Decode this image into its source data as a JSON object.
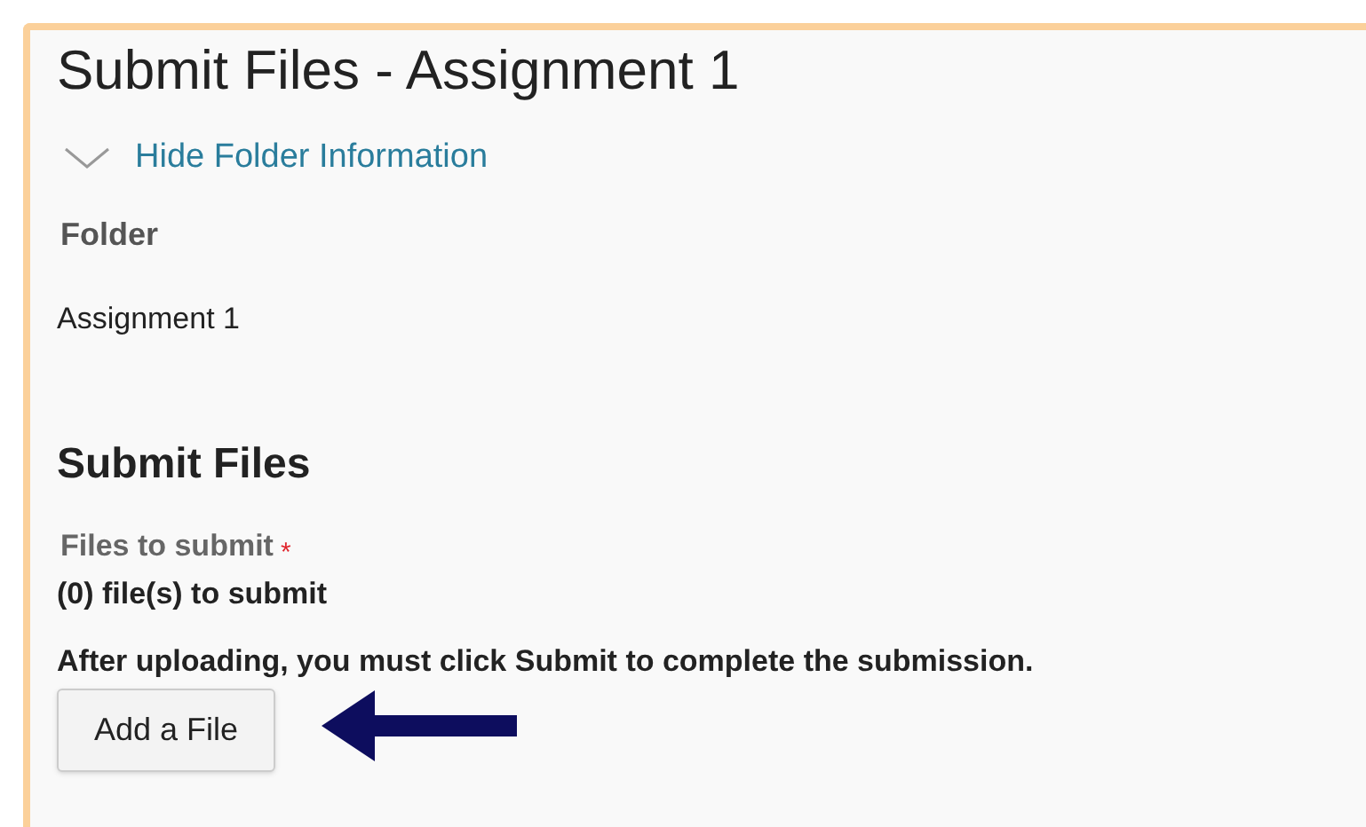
{
  "page": {
    "title": "Submit Files - Assignment 1"
  },
  "folder_toggle": {
    "label": "Hide Folder Information",
    "expanded": true
  },
  "folder": {
    "label": "Folder",
    "value": "Assignment 1"
  },
  "submit_section": {
    "heading": "Submit Files",
    "field_label": "Files to submit",
    "required_mark": "*",
    "file_count": "(0) file(s) to submit",
    "instruction": "After uploading, you must click Submit to complete the submission.",
    "button": "Add a File"
  }
}
